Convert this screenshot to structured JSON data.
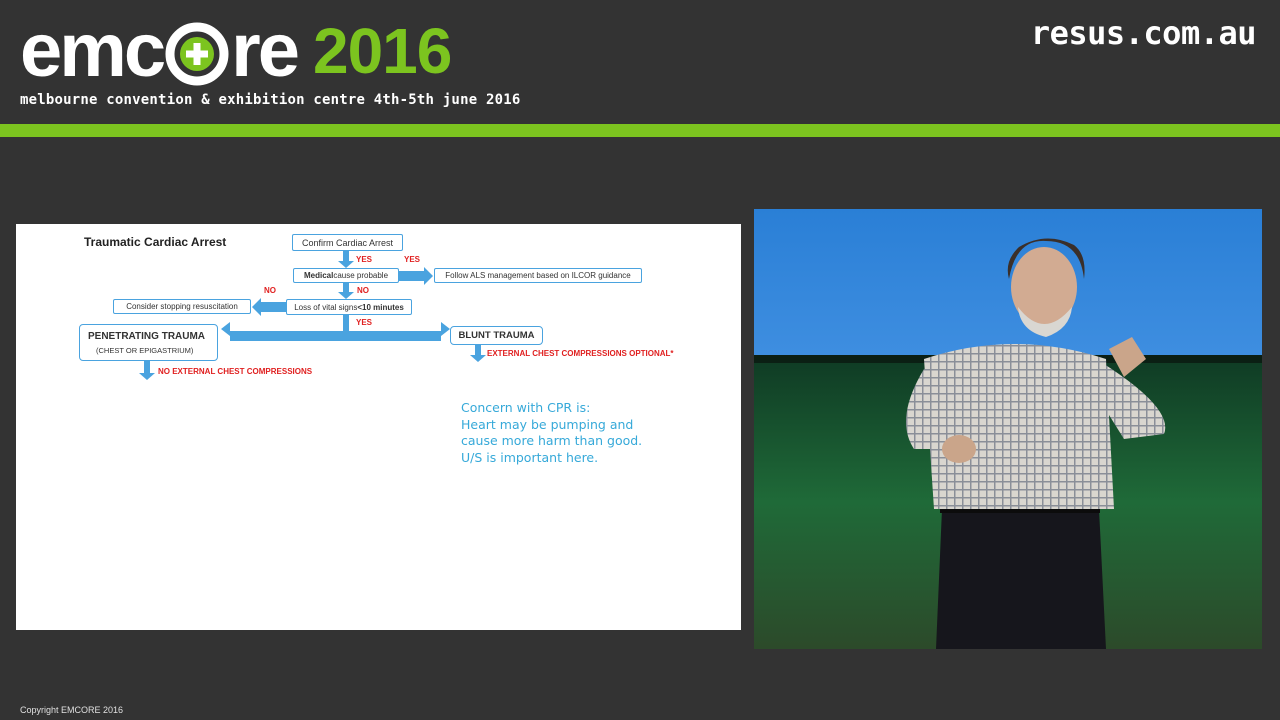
{
  "header": {
    "logo_left": "emc",
    "logo_right": "re",
    "logo_year": "2016",
    "venue": "melbourne convention & exhibition centre 4th-5th june 2016",
    "site": "resus.com.au"
  },
  "slide": {
    "title": "Traumatic Cardiac Arrest",
    "boxes": {
      "confirm": "Confirm Cardiac Arrest",
      "medical_bold": "Medical",
      "medical_rest": " cause probable",
      "als": "Follow ALS management based on ILCOR guidance",
      "stopping": "Consider stopping resuscitation",
      "vitals_prefix": "Loss of vital signs ",
      "vitals_bold": "<10 minutes",
      "penetrating": "PENETRATING TRAUMA",
      "penetrating_sub": "(CHEST OR EPIGASTRIUM)",
      "blunt": "BLUNT TRAUMA"
    },
    "labels": {
      "yes1": "YES",
      "yes2": "YES",
      "no1": "NO",
      "no2": "NO",
      "yes3": "YES",
      "no_compressions": "NO EXTERNAL CHEST COMPRESSIONS",
      "optional_compressions": "EXTERNAL CHEST COMPRESSIONS OPTIONAL*"
    },
    "note": [
      "Concern with CPR is:",
      "Heart may be pumping and",
      "cause more harm than good.",
      "U/S is important here."
    ]
  },
  "colors": {
    "brand_green": "#7cc41f",
    "background": "#333333",
    "flow_blue": "#4aa3df",
    "label_red": "#e02020",
    "note_blue": "#36a9d9"
  },
  "footer": {
    "copyright": "Copyright EMCORE 2016"
  }
}
